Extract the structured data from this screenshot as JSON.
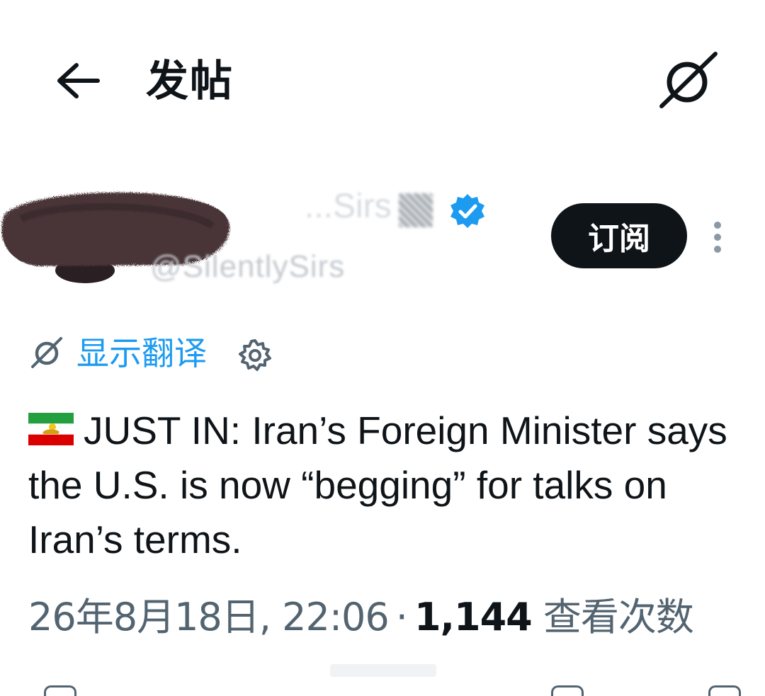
{
  "header": {
    "back_icon": "arrow-left-icon",
    "title": "发帖",
    "grok_icon": "grok-icon"
  },
  "author": {
    "display_name": "...Sirs",
    "handle": "@SilentlySirs",
    "verified_icon": "verified-badge-icon",
    "verified_color": "#1d9bf0",
    "subscribe_label": "订阅",
    "more_icon": "more-vertical-icon"
  },
  "translate": {
    "icon": "grok-translate-icon",
    "label": "显示翻译",
    "settings_icon": "gear-icon",
    "link_color": "#1d9bf0"
  },
  "tweet": {
    "flag_icon": "iran-lion-and-sun-flag-icon",
    "text": "JUST IN: Iran’s Foreign Minister says the U.S. is now “begging” for talks on Iran’s terms."
  },
  "meta": {
    "date": "26年8月18日",
    "time": "22:06",
    "separator": "·",
    "views_count": "1,144",
    "views_label": "查看次数"
  }
}
